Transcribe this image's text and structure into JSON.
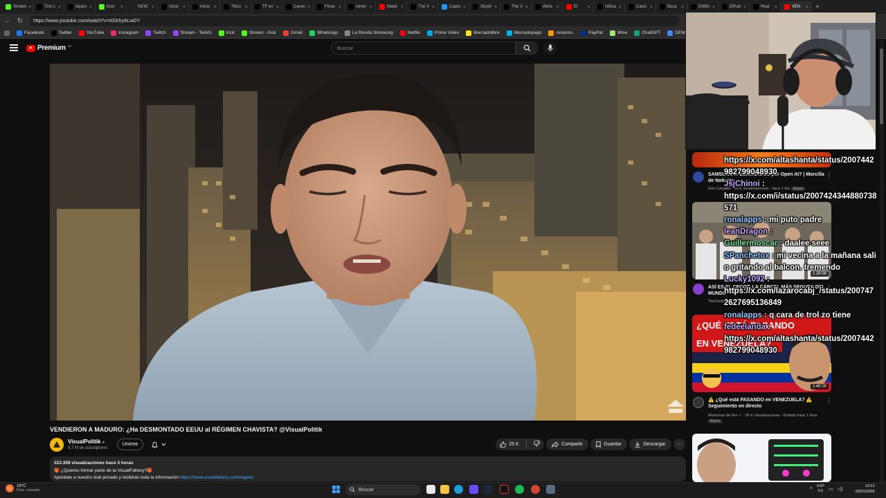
{
  "browser": {
    "tabs": [
      {
        "label": "Stream",
        "color": "#53fc18"
      },
      {
        "label": "Tino c",
        "color": "#000000"
      },
      {
        "label": "lázaro",
        "color": "#000000"
      },
      {
        "label": "Kick",
        "color": "#53fc18"
      },
      {
        "label": "NEW:",
        "color": "#222222"
      },
      {
        "label": "Inicio",
        "color": "#000000"
      },
      {
        "label": "Inicio",
        "color": "#000000"
      },
      {
        "label": "\"Nico",
        "color": "#000000"
      },
      {
        "label": "TF en",
        "color": "#000000"
      },
      {
        "label": "Cavec",
        "color": "#000000"
      },
      {
        "label": "Finan",
        "color": "#000000"
      },
      {
        "label": "Ionen",
        "color": "#000000"
      },
      {
        "label": "Madu",
        "color": "#ff0000"
      },
      {
        "label": "The V",
        "color": "#000000"
      },
      {
        "label": "Captu",
        "color": "#2196f3"
      },
      {
        "label": "Skysh",
        "color": "#000000"
      },
      {
        "label": "The V",
        "color": "#000000"
      },
      {
        "label": "Abrie",
        "color": "#000000"
      },
      {
        "label": "El",
        "color": "#ff0000"
      },
      {
        "label": "Utiliza",
        "color": "#000000"
      },
      {
        "label": "Canci",
        "color": "#000000"
      },
      {
        "label": "Boca",
        "color": "#000000"
      },
      {
        "label": "ENBA",
        "color": "#000000"
      },
      {
        "label": "ElPub",
        "color": "#000000"
      },
      {
        "label": "Real",
        "color": "#000000"
      },
      {
        "label": "VEN",
        "color": "#ff0000"
      }
    ],
    "new_tab": "+",
    "url": "https://www.youtube.com/watch?v=433rhyALwDY",
    "bookmarks": [
      {
        "label": "Facebook",
        "color": "#1877f2"
      },
      {
        "label": "Twitter",
        "color": "#000000"
      },
      {
        "label": "YouTube",
        "color": "#ff0000"
      },
      {
        "label": "Instagram",
        "color": "#e1306c"
      },
      {
        "label": "Twitch",
        "color": "#9146ff"
      },
      {
        "label": "Stream - Twitch",
        "color": "#9146ff"
      },
      {
        "label": "Kick",
        "color": "#53fc18"
      },
      {
        "label": "Stream - Kick",
        "color": "#53fc18"
      },
      {
        "label": "Gmail",
        "color": "#ea4335"
      },
      {
        "label": "WhatsApp",
        "color": "#25d366"
      },
      {
        "label": "La Ronda Simracing",
        "color": "#888888"
      },
      {
        "label": "Netflix",
        "color": "#e50914"
      },
      {
        "label": "Prime Video",
        "color": "#00a8e1"
      },
      {
        "label": "Mercadolibre",
        "color": "#ffe600"
      },
      {
        "label": "Mercadopago",
        "color": "#00b1ea"
      },
      {
        "label": "Amazon.",
        "color": "#ff9900"
      },
      {
        "label": "PayPal",
        "color": "#003087"
      },
      {
        "label": "Wise",
        "color": "#9fe870"
      },
      {
        "label": "ChatGPT",
        "color": "#10a37f"
      },
      {
        "label": "DEMOS PAL STR",
        "color": "#4285f4"
      }
    ]
  },
  "youtube": {
    "logo_text": "Premium",
    "logo_country": "AR",
    "search_placeholder": "Buscar",
    "video": {
      "title": "VENDIERON A MADURO: ¿Ha DESMONTADO EEUU al RÉGIMEN CHAVISTA? @VisualPolitik"
    },
    "channel": {
      "name": "VisualPolitik",
      "subs": "3,7 M de suscriptores",
      "join_label": "Unirme"
    },
    "actions": {
      "likes": "25 K",
      "share": "Compartir",
      "save": "Guardar",
      "download": "Descargar",
      "more": "···"
    },
    "description": {
      "line1": "223.359 visualizaciones  hace 3 horas",
      "line2": "🎁 ¿Quieres formar parte de la VisualFaktory?🎁",
      "line3": "Apúntate a nuestro club privado y recibirás toda la información ",
      "link": "https://www.visualfaktory.com/regalo/"
    },
    "recommendations": [
      {
        "title": "SAMSUNG ... ELIMINADOS por Open AI? | Morcilla de Noticias",
        "sub": "Edu Campillo · 10 K visualizaciones · hace 1 día",
        "badge": "Nuevo"
      },
      {
        "title": "ASÍ ES EL CECOT: LA CÁRCEL MÁS SEGURA DEL MUNDO",
        "sub": "TheGrefg",
        "duration": "1:28:58"
      },
      {
        "thumb_text_1": "¿QUÉ ESTÁ PASANDO",
        "thumb_text_2": "EN VENEZUELA?",
        "title": "⚠️ ¿Qué está PASANDO en VENEZUELA? ⚠️ Seguimiento en directo",
        "sub": "Memorias de Pez ✓ · 65 K visualizaciones · Emitido hace 1 hora",
        "badge": "Nuevo",
        "duration": "1:40:28"
      }
    ]
  },
  "chat": [
    {
      "user": "",
      "text": "https://x.com/altashanta/status/2007442982799048930"
    },
    {
      "user": "JsjChinoi",
      "text": ":"
    },
    {
      "user": "",
      "text": "https://x.com/i/status/2007424344880738571"
    },
    {
      "user": "ronalapps",
      "text": ": mi puto padre"
    },
    {
      "user": "leanDragon",
      "text": ":"
    },
    {
      "user": "Guillermoscar",
      "text": ": daalee seee"
    },
    {
      "user": "SPanchetox",
      "text": ": mi vecina a la mañana salio gritando al balcon. tremendo"
    },
    {
      "user": "Lucky1092",
      "text": ":"
    },
    {
      "user": "",
      "text": "https://x.com/lazarocabj_/status/2007472627695136849"
    },
    {
      "user": "ronalapps",
      "text": ": q cara de trol zo tiene"
    },
    {
      "user": "fedeelanda",
      "text": ":"
    },
    {
      "user": "",
      "text": "https://x.com/altashanta/status/2007442982799048930"
    }
  ],
  "taskbar": {
    "temperature": "18°C",
    "weather": "Parc. soleado",
    "search": "Buscar",
    "lang_1": "ESP",
    "lang_2": "ES",
    "time": "13:12",
    "date": "03/01/2026"
  },
  "colors": {
    "youtube_red": "#ff0000",
    "link_blue": "#3ea6ff",
    "background": "#0f0f0f"
  }
}
